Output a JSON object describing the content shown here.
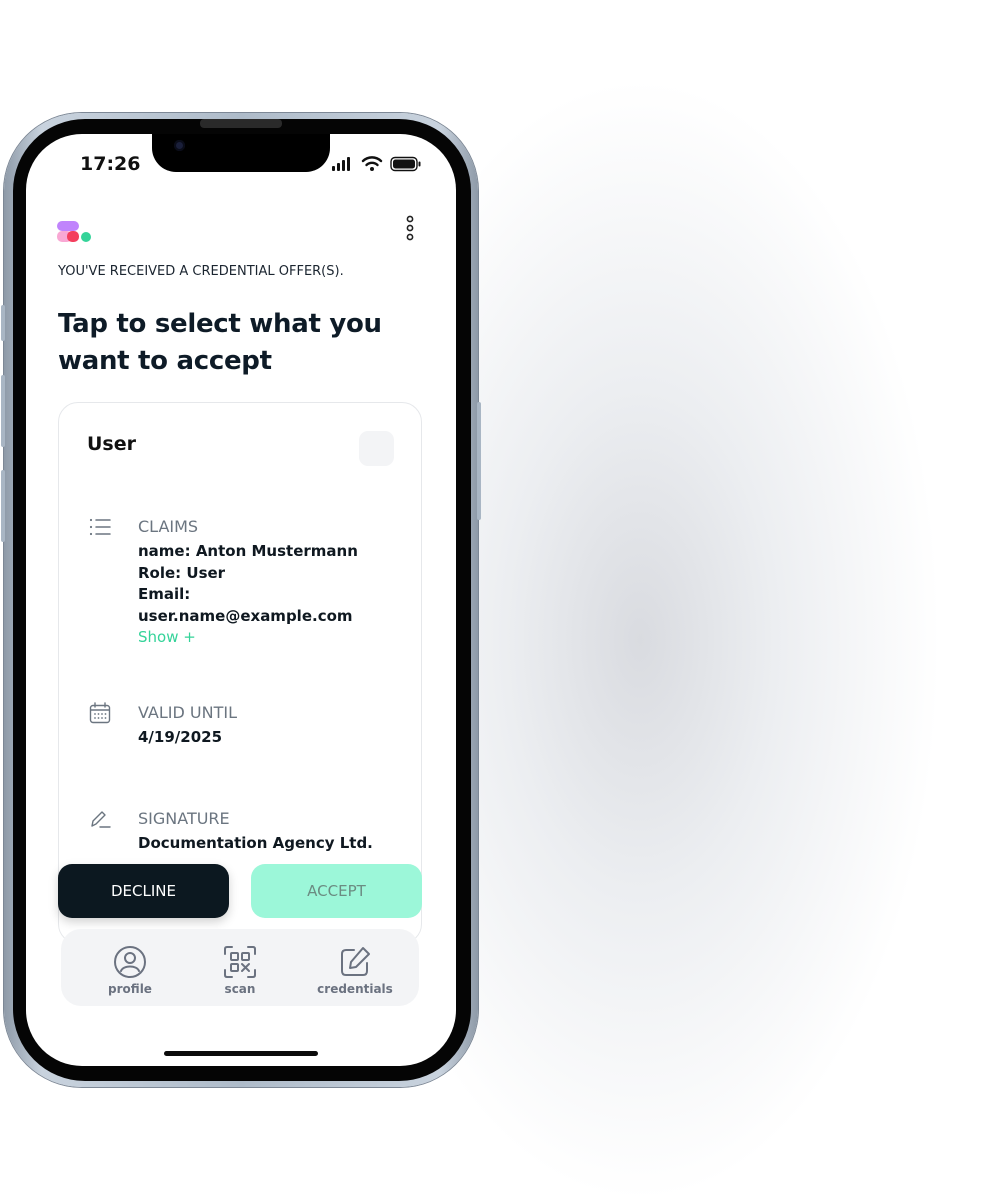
{
  "status_bar": {
    "time": "17:26"
  },
  "header": {
    "subtitle": "YOU'VE RECEIVED A CREDENTIAL OFFER(S).",
    "title": "Tap to select what you want to accept"
  },
  "card": {
    "title": "User",
    "claims": {
      "label": "CLAIMS",
      "lines": [
        "name: Anton Mustermann",
        "Role: User",
        "Email:",
        "user.name@example.com"
      ],
      "show_label": "Show +"
    },
    "valid_until": {
      "label": "VALID UNTIL",
      "value": "4/19/2025"
    },
    "signature": {
      "label": "SIGNATURE",
      "value": "Documentation Agency Ltd."
    }
  },
  "actions": {
    "decline_label": "DECLINE",
    "accept_label": "ACCEPT"
  },
  "tabs": [
    {
      "label": "profile",
      "icon": "profile-icon"
    },
    {
      "label": "scan",
      "icon": "qr-scan-icon"
    },
    {
      "label": "credentials",
      "icon": "edit-credentials-icon"
    }
  ],
  "colors": {
    "accent": "#34d399",
    "accept_bg": "#9cf7d9",
    "decline_bg": "#0c1820",
    "logo_purple": "#c084fc",
    "logo_pink": "#f9a8d4",
    "logo_red": "#f43f5e",
    "logo_green": "#34d399"
  }
}
